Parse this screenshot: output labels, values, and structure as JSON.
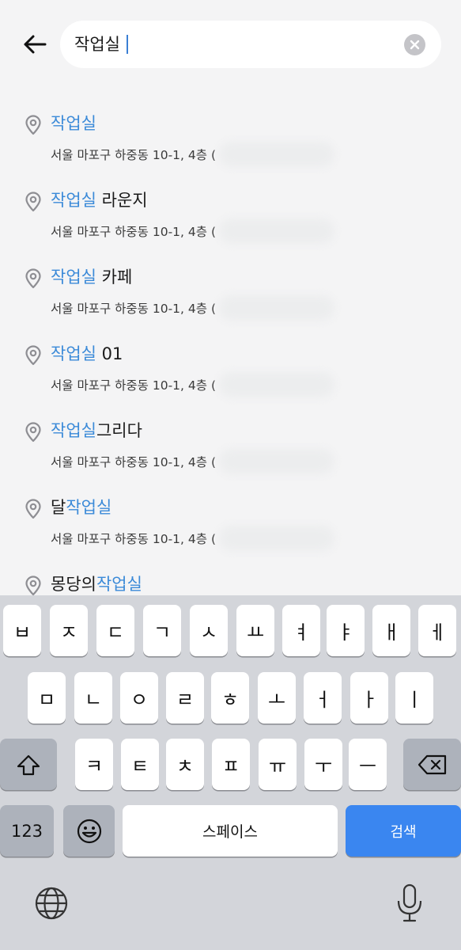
{
  "search": {
    "query": "작업실",
    "back_icon": "arrow-left-icon",
    "clear_icon": "clear-circle-icon"
  },
  "colors": {
    "highlight": "#3b8ad8",
    "background": "#f4f4f5",
    "search_key": "#3a86f0",
    "keyboard_bg": "#d3d5da"
  },
  "results": [
    {
      "prefix": "",
      "match": "작업실",
      "suffix": "",
      "address": "서울 마포구 하중동 10-1, 4층 ("
    },
    {
      "prefix": "",
      "match": "작업실",
      "suffix": " 라운지",
      "address": "서울 마포구 하중동 10-1, 4층 ("
    },
    {
      "prefix": "",
      "match": "작업실",
      "suffix": " 카페",
      "address": "서울 마포구 하중동 10-1, 4층 ("
    },
    {
      "prefix": "",
      "match": "작업실",
      "suffix": " 01",
      "address": "서울 마포구 하중동 10-1, 4층 ("
    },
    {
      "prefix": "",
      "match": "작업실",
      "suffix": "그리다",
      "address": "서울 마포구 하중동 10-1, 4층 ("
    },
    {
      "prefix": "달",
      "match": "작업실",
      "suffix": "",
      "address": "서울 마포구 하중동 10-1, 4층 ("
    },
    {
      "prefix": "몽당의",
      "match": "작업실",
      "suffix": "",
      "address": ""
    }
  ],
  "keyboard": {
    "row1": [
      "ㅂ",
      "ㅈ",
      "ㄷ",
      "ㄱ",
      "ㅅ",
      "ㅛ",
      "ㅕ",
      "ㅑ",
      "ㅐ",
      "ㅔ"
    ],
    "row2": [
      "ㅁ",
      "ㄴ",
      "ㅇ",
      "ㄹ",
      "ㅎ",
      "ㅗ",
      "ㅓ",
      "ㅏ",
      "ㅣ"
    ],
    "row3": [
      "ㅋ",
      "ㅌ",
      "ㅊ",
      "ㅍ",
      "ㅠ",
      "ㅜ",
      "ㅡ"
    ],
    "shift_icon": "shift-icon",
    "backspace_icon": "backspace-icon",
    "numbers_label": "123",
    "emoji_icon": "emoji-icon",
    "space_label": "스페이스",
    "search_label": "검색",
    "globe_icon": "globe-icon",
    "mic_icon": "microphone-icon"
  }
}
